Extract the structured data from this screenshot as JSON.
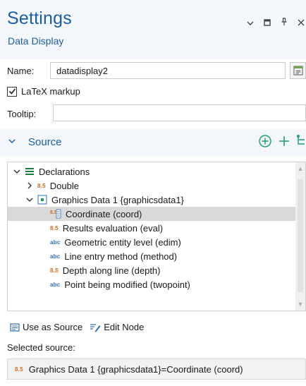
{
  "header": {
    "title": "Settings",
    "subtitle": "Data Display",
    "controls": [
      "chevron-down-icon",
      "maximize-icon",
      "pin-icon",
      "close-icon"
    ]
  },
  "form": {
    "name_label": "Name:",
    "name_value": "datadisplay2",
    "latex_label": "LaTeX markup",
    "latex_checked": true,
    "tooltip_label": "Tooltip:",
    "tooltip_value": ""
  },
  "source": {
    "title": "Source",
    "tools": [
      "add-circle-icon",
      "plus-icon",
      "tree-node-icon"
    ],
    "tree": [
      {
        "label": "Declarations",
        "level": 0,
        "expander": "expanded",
        "icon": "declarations-icon"
      },
      {
        "label": "Double",
        "level": 1,
        "expander": "collapsed",
        "icon": "8.5"
      },
      {
        "label": "Graphics Data 1 {graphicsdata1}",
        "level": 1,
        "expander": "expanded",
        "icon": "graphics-data-icon"
      },
      {
        "label": "Coordinate (coord)",
        "level": 2,
        "expander": "none",
        "icon": "coordinate-icon",
        "selected": true
      },
      {
        "label": "Results evaluation (eval)",
        "level": 2,
        "expander": "none",
        "icon": "8.5"
      },
      {
        "label": "Geometric entity level (edim)",
        "level": 2,
        "expander": "none",
        "icon": "abc"
      },
      {
        "label": "Line entry method (method)",
        "level": 2,
        "expander": "none",
        "icon": "abc"
      },
      {
        "label": "Depth along line (depth)",
        "level": 2,
        "expander": "none",
        "icon": "8.5"
      },
      {
        "label": "Point being modified (twopoint)",
        "level": 2,
        "expander": "none",
        "icon": "abc"
      }
    ]
  },
  "actions": {
    "use_as_source": "Use as Source",
    "edit_node": "Edit Node"
  },
  "selected": {
    "label": "Selected source:",
    "value": "Graphics Data 1 {graphicsdata1}=Coordinate (coord)",
    "icon": "8.5"
  },
  "colors": {
    "accent": "#1b5f9e",
    "header_bg": "#f3f6fa",
    "selection": "#d9d9d9",
    "num_tag": "#d06a1a",
    "abc_tag": "#2e6fb5"
  }
}
